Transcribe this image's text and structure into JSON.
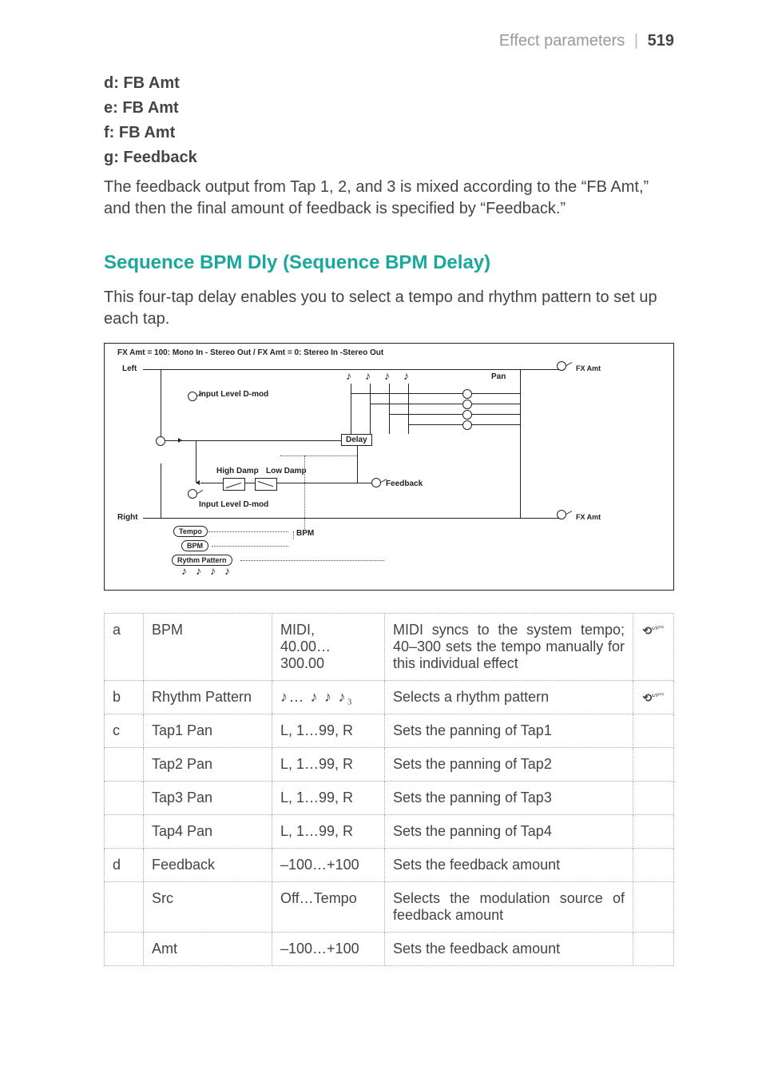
{
  "header": {
    "section": "Effect parameters",
    "page_number": "519"
  },
  "intro": {
    "l1": "d: FB Amt",
    "l2": "e: FB Amt",
    "l3": "f: FB Amt",
    "l4": "g: Feedback",
    "body": "The feedback output from Tap 1, 2, and 3 is mixed according to the “FB Amt,” and then the final amount of feedback is specified by “Feedback.”"
  },
  "section": {
    "title": "Sequence BPM Dly (Sequence BPM Delay)",
    "body": "This four-tap delay enables you to select a tempo and rhythm pattern to set up each tap."
  },
  "diagram": {
    "top_caption": "FX Amt = 100: Mono In - Stereo Out  /  FX Amt = 0: Stereo In -Stereo Out",
    "left": "Left",
    "right": "Right",
    "fx_amt": "FX Amt",
    "pan": "Pan",
    "delay": "Delay",
    "feedback": "Feedback",
    "input_level": "Input Level D-mod",
    "high_damp": "High Damp",
    "low_damp": "Low Damp",
    "tempo": "Tempo",
    "bpm": "BPM",
    "rhythm": "Rythm Pattern"
  },
  "table": {
    "rows": [
      {
        "letter": "a",
        "name": "BPM",
        "range": "MIDI, 40.00…300.00",
        "desc": "MIDI syncs to the system tempo; 40–300 sets the tempo manually for this individual effect",
        "icon": true
      },
      {
        "letter": "b",
        "name": "Rhythm Pattern",
        "range": "__RHYTHM__",
        "desc": "Selects a rhythm pattern",
        "icon": true
      },
      {
        "letter": "c",
        "name": "Tap1 Pan",
        "range": "L, 1…99, R",
        "desc": "Sets the panning of Tap1",
        "icon": false
      },
      {
        "letter": "",
        "name": "Tap2 Pan",
        "range": "L, 1…99, R",
        "desc": "Sets the panning of Tap2",
        "icon": false
      },
      {
        "letter": "",
        "name": "Tap3 Pan",
        "range": "L, 1…99, R",
        "desc": "Sets the panning of Tap3",
        "icon": false
      },
      {
        "letter": "",
        "name": "Tap4 Pan",
        "range": "L, 1…99, R",
        "desc": "Sets the panning of Tap4",
        "icon": false
      },
      {
        "letter": "d",
        "name": "Feedback",
        "range": "–100…+100",
        "desc": "Sets the feedback amount",
        "icon": false
      },
      {
        "letter": "",
        "name": "Src",
        "range": "Off…Tempo",
        "desc": "Selects the modulation source of feedback amount",
        "icon": false
      },
      {
        "letter": "",
        "name": "Amt",
        "range": "–100…+100",
        "desc": "Sets the feedback amount",
        "icon": false
      }
    ],
    "rhythm_range_text": "♪… ♪ ♪ ♪₃"
  }
}
